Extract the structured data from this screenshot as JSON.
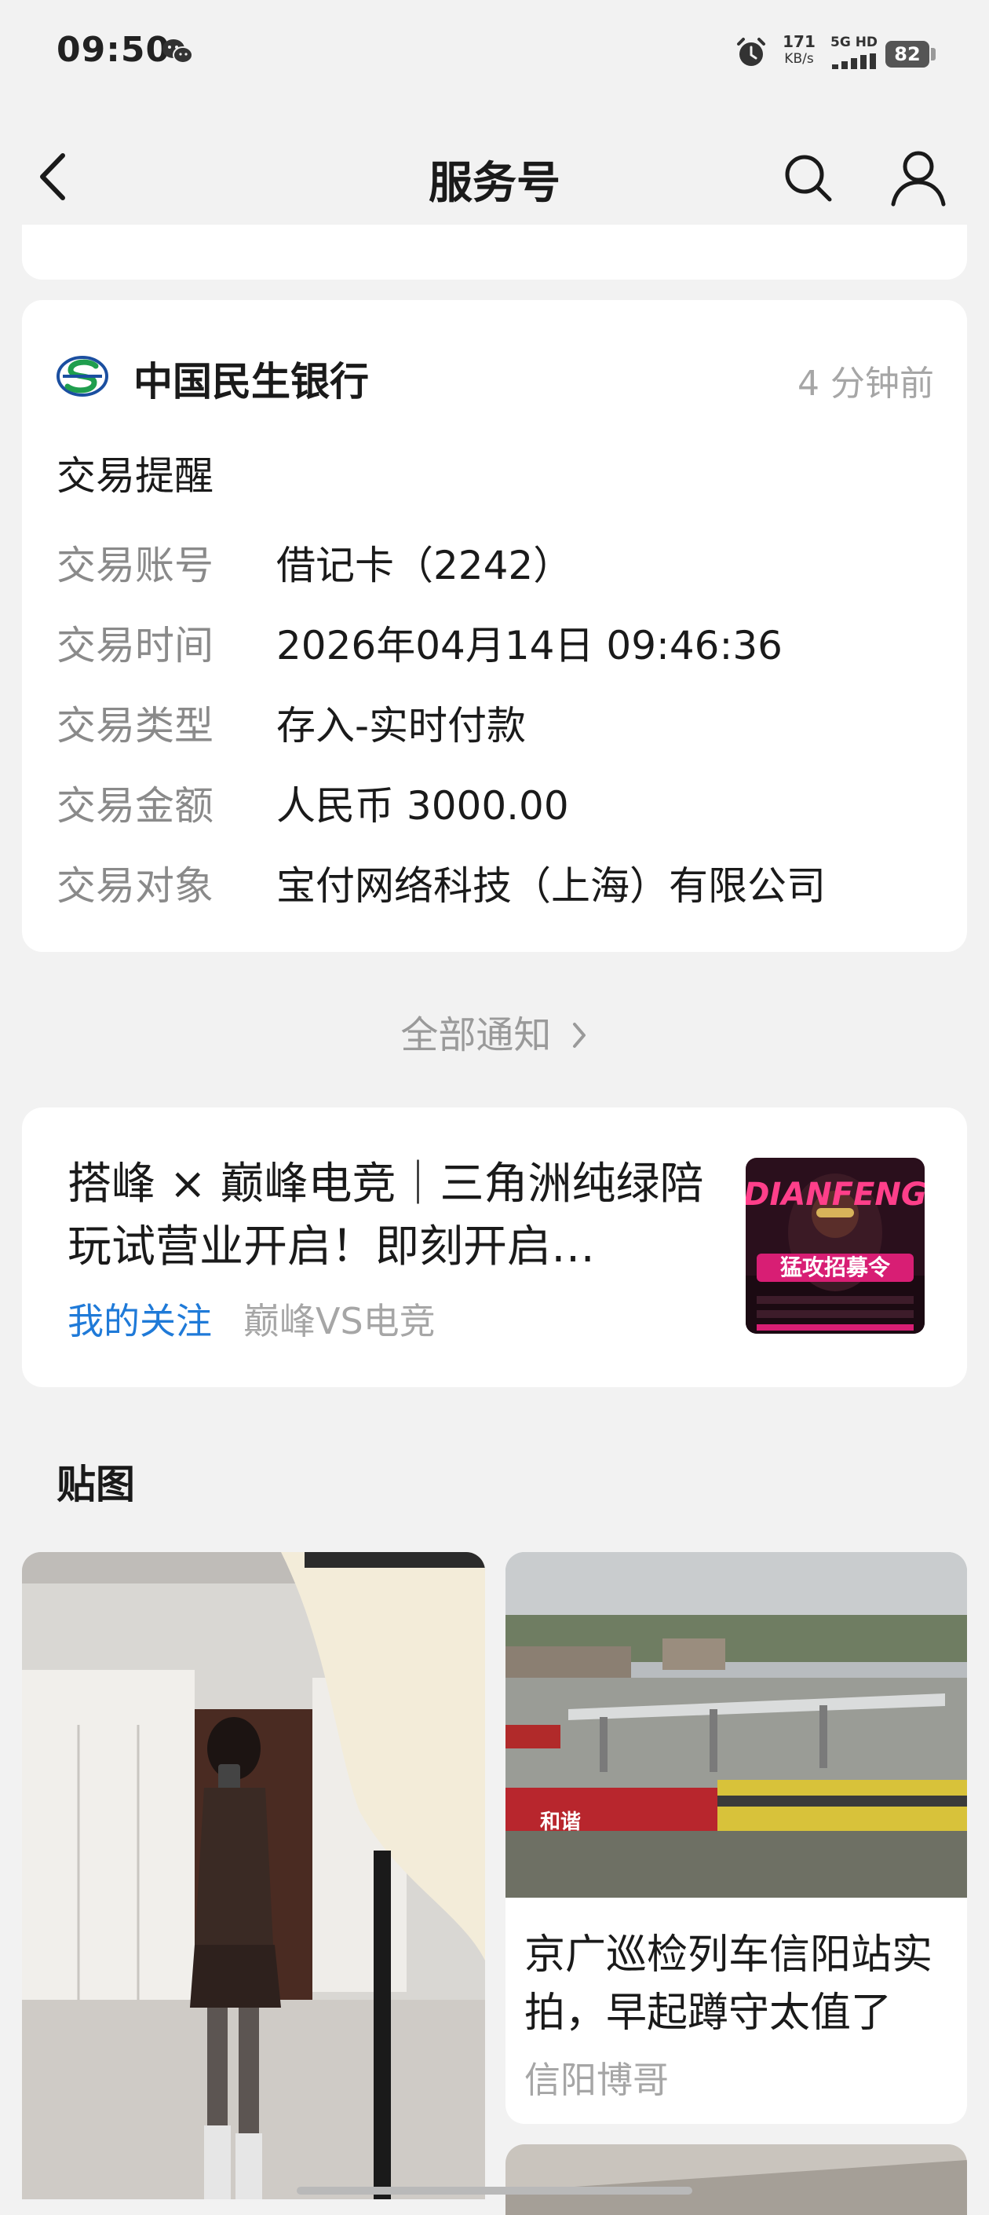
{
  "status_bar": {
    "time": "09:50",
    "wechat_icon": "wechat-icon",
    "alarm_icon": "alarm-icon",
    "net_speed_value": "171",
    "net_speed_unit": "KB/s",
    "network_type": "5G HD",
    "battery": "82"
  },
  "header": {
    "title": "服务号",
    "back_icon": "chevron-left-icon",
    "search_icon": "search-icon",
    "profile_icon": "person-icon"
  },
  "bank_message": {
    "sender": "中国民生银行",
    "time_ago": "4 分钟前",
    "title": "交易提醒",
    "rows": [
      {
        "label": "交易账号",
        "value": "借记卡（2242）"
      },
      {
        "label": "交易时间",
        "value": "2026年04月14日 09:46:36"
      },
      {
        "label": "交易类型",
        "value": "存入-实时付款"
      },
      {
        "label": "交易金额",
        "value": "人民币 3000.00"
      },
      {
        "label": "交易对象",
        "value": "宝付网络科技（上海）有限公司"
      }
    ]
  },
  "all_notifications": "全部通知",
  "article": {
    "title": "搭峰 × 巅峰电竞｜三角洲纯绿陪玩试营业开启！即刻开启…",
    "follow_label": "我的关注",
    "source": "巅峰VS电竞",
    "thumb_text_1": "DIANFENG",
    "thumb_text_2": "猛攻招募令"
  },
  "section": {
    "title": "贴图"
  },
  "photos": [
    {
      "title": "",
      "author": ""
    },
    {
      "title": "京广巡检列车信阳站实拍，早起蹲守太值了",
      "author": "信阳博哥",
      "train_text": "和谐"
    }
  ],
  "colors": {
    "background": "#f2f2f2",
    "card": "#ffffff",
    "link": "#1f7ad8",
    "muted": "#a6a6a6",
    "bank_logo_green": "#1f9e4e",
    "bank_logo_blue": "#1b4fa0"
  }
}
